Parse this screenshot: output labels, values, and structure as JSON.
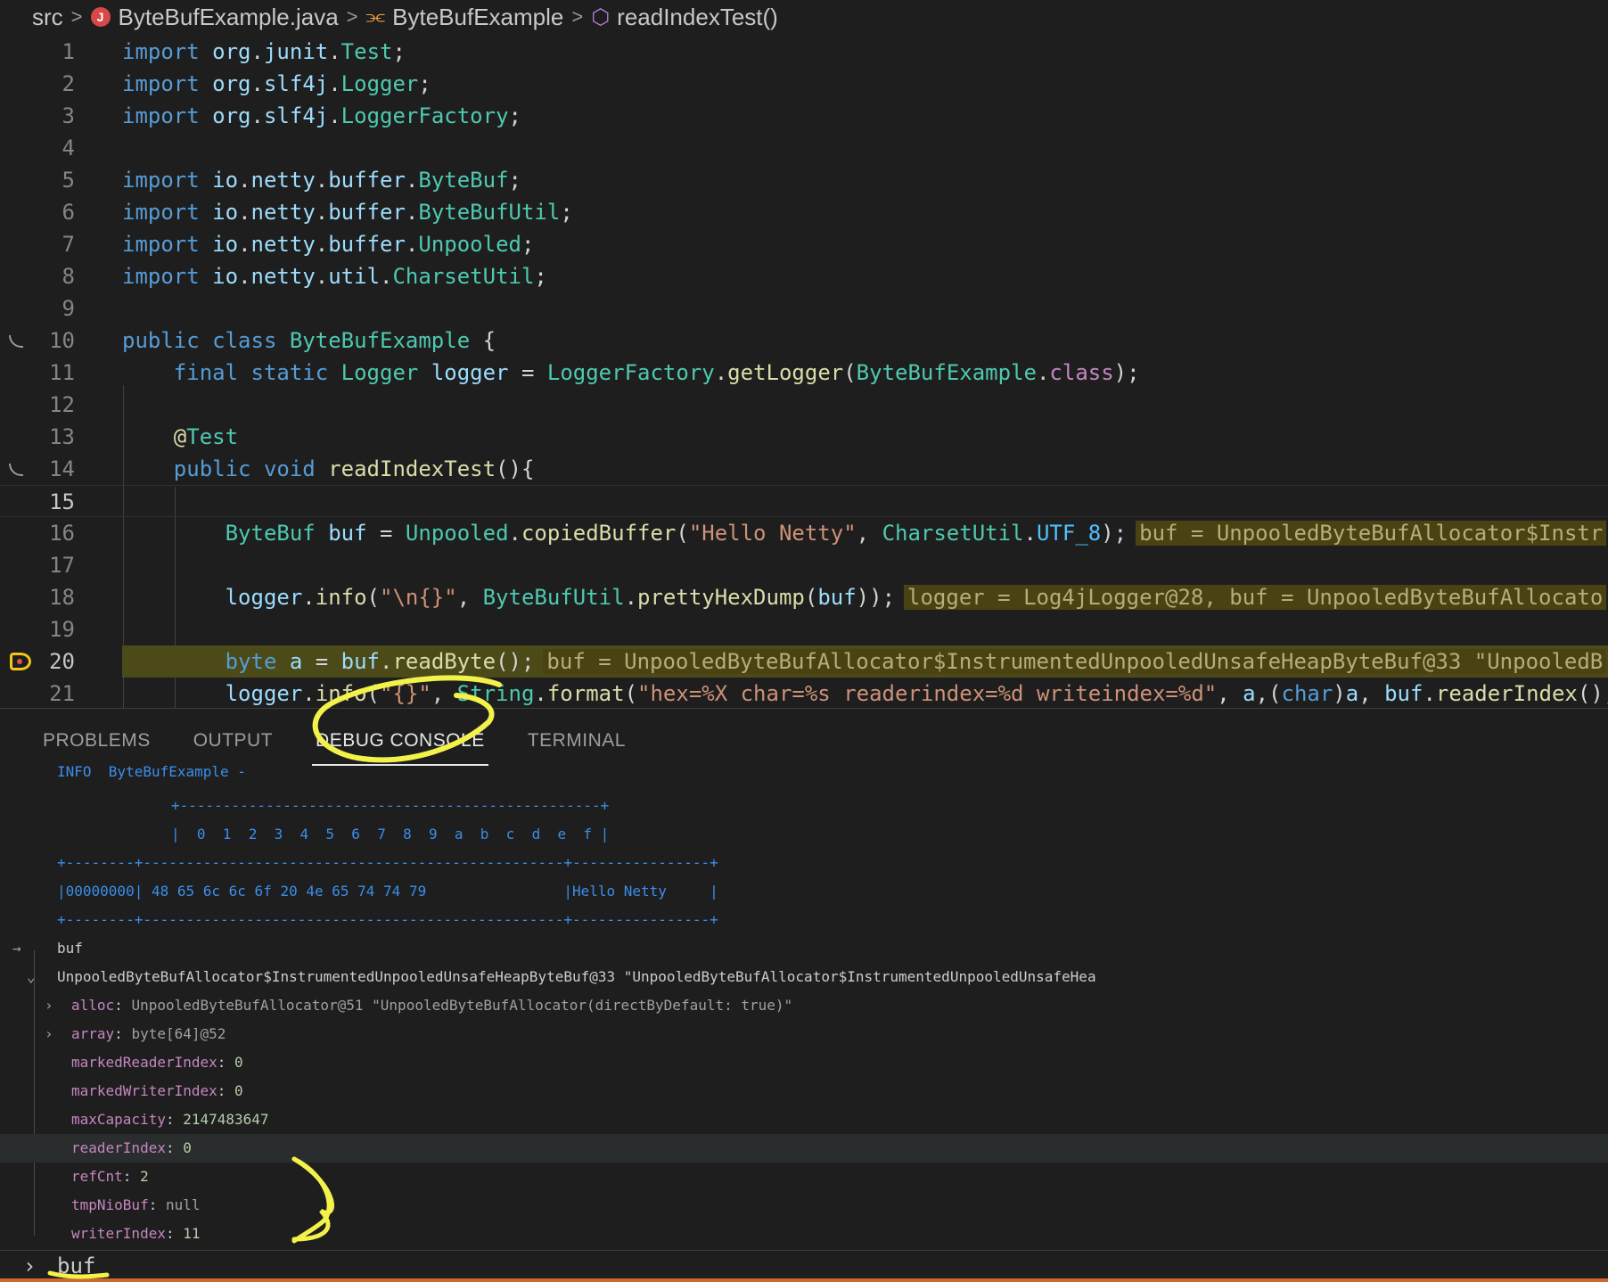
{
  "breadcrumb": {
    "root": "src",
    "file": "ByteBufExample.java",
    "class": "ByteBufExample",
    "method": "readIndexTest()"
  },
  "editor": {
    "line_numbers": [
      "1",
      "2",
      "3",
      "4",
      "5",
      "6",
      "7",
      "8",
      "9",
      "10",
      "11",
      "12",
      "13",
      "14",
      "15",
      "16",
      "17",
      "18",
      "19",
      "20",
      "21"
    ],
    "inline_values": {
      "l16": "buf = UnpooledByteBufAllocator$Instr",
      "l18": "logger = Log4jLogger@28, buf = UnpooledByteBufAllocato",
      "l20": "buf = UnpooledByteBufAllocator$InstrumentedUnpooledUnsafeHeapByteBuf@33 \"UnpooledB"
    }
  },
  "panel": {
    "tabs": [
      "PROBLEMS",
      "OUTPUT",
      "DEBUG CONSOLE",
      "TERMINAL"
    ],
    "active_tab": "DEBUG CONSOLE"
  },
  "console": {
    "log_header": "INFO  ByteBufExample -",
    "hex_top_border": "+-------------------------------------------------+",
    "hex_columns": "|  0  1  2  3  4  5  6  7  8  9  a  b  c  d  e  f |",
    "hex_mid_border": "+--------+-------------------------------------------------+----------------+",
    "hex_row": "|00000000| 48 65 6c 6c 6f 20 4e 65 74 74 79                |Hello Netty     |",
    "hex_bottom_border": "+--------+-------------------------------------------------+----------------+",
    "eval_expr": "buf",
    "object_label": "UnpooledByteBufAllocator$InstrumentedUnpooledUnsafeHeapByteBuf@33 \"UnpooledByteBufAllocator$InstrumentedUnpooledUnsafeHea",
    "fields": [
      {
        "name": "alloc",
        "value": "UnpooledByteBufAllocator@51 \"UnpooledByteBufAllocator(directByDefault: true)\"",
        "expandable": true
      },
      {
        "name": "array",
        "value": "byte[64]@52",
        "expandable": true
      },
      {
        "name": "markedReaderIndex",
        "value": "0",
        "expandable": false
      },
      {
        "name": "markedWriterIndex",
        "value": "0",
        "expandable": false
      },
      {
        "name": "maxCapacity",
        "value": "2147483647",
        "expandable": false
      },
      {
        "name": "readerIndex",
        "value": "0",
        "expandable": false
      },
      {
        "name": "refCnt",
        "value": "2",
        "expandable": false
      },
      {
        "name": "tmpNioBuf",
        "value": "null",
        "expandable": false
      },
      {
        "name": "writerIndex",
        "value": "11",
        "expandable": false
      }
    ],
    "input_value": "buf"
  },
  "colors": {
    "background": "#1e1e1e",
    "breakpoint_highlight": "#4b4a18",
    "annotation": "#f2f24a",
    "console_blue": "#3b8eea"
  }
}
